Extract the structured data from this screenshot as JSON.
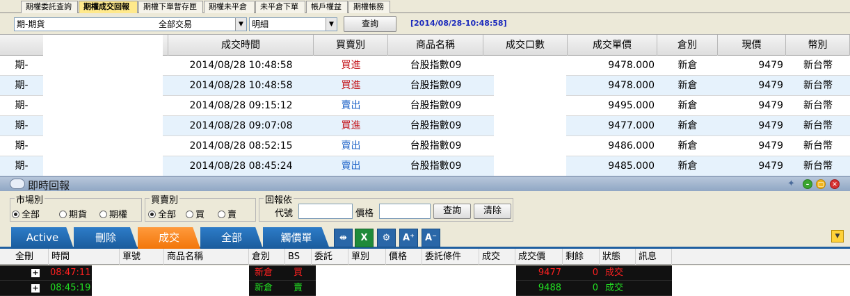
{
  "top_tabs": [
    {
      "label": "期權委託查詢"
    },
    {
      "label": "期權成交回報"
    },
    {
      "label": "期權下單暫存匣"
    },
    {
      "label": "期權未平倉"
    },
    {
      "label": "未平倉下單"
    },
    {
      "label": "帳戶權益"
    },
    {
      "label": "期權帳務"
    }
  ],
  "query": {
    "account_value": "期-期貨",
    "trade_type_value": "全部交易",
    "detail_value": "明細",
    "query_button": "查詢",
    "timestamp": "[2014/08/28-10:48:58]"
  },
  "trade_table": {
    "headers": [
      "成交時間",
      "買賣別",
      "商品名稱",
      "成交口數",
      "成交單價",
      "倉別",
      "現價",
      "幣別"
    ],
    "rows": [
      {
        "account": "期-",
        "time": "2014/08/28 10:48:58",
        "side": "買進",
        "side_type": "buy",
        "product": "台股指數09",
        "price": "9478.000",
        "position": "新倉",
        "current": "9479",
        "currency": "新台幣"
      },
      {
        "account": "期-",
        "time": "2014/08/28 10:48:58",
        "side": "買進",
        "side_type": "buy",
        "product": "台股指數09",
        "price": "9478.000",
        "position": "新倉",
        "current": "9479",
        "currency": "新台幣"
      },
      {
        "account": "期-",
        "time": "2014/08/28 09:15:12",
        "side": "賣出",
        "side_type": "sell",
        "product": "台股指數09",
        "price": "9495.000",
        "position": "新倉",
        "current": "9479",
        "currency": "新台幣"
      },
      {
        "account": "期-",
        "time": "2014/08/28 09:07:08",
        "side": "買進",
        "side_type": "buy",
        "product": "台股指數09",
        "price": "9477.000",
        "position": "新倉",
        "current": "9479",
        "currency": "新台幣"
      },
      {
        "account": "期-",
        "time": "2014/08/28 08:52:15",
        "side": "賣出",
        "side_type": "sell",
        "product": "台股指數09",
        "price": "9486.000",
        "position": "新倉",
        "current": "9479",
        "currency": "新台幣"
      },
      {
        "account": "期-",
        "time": "2014/08/28 08:45:24",
        "side": "賣出",
        "side_type": "sell",
        "product": "台股指數09",
        "price": "9485.000",
        "position": "新倉",
        "current": "9479",
        "currency": "新台幣"
      }
    ]
  },
  "realtime_panel": {
    "title": "即時回報",
    "market_group": {
      "title": "市場別",
      "options": [
        "全部",
        "期貨",
        "期權"
      ],
      "selected": 0
    },
    "side_group": {
      "title": "買賣別",
      "options": [
        "全部",
        "買",
        "賣"
      ],
      "selected": 0
    },
    "filter_group": {
      "title": "回報依",
      "code_label": "代號",
      "price_label": "價格",
      "query_button": "查詢",
      "clear_button": "清除"
    },
    "tabs": [
      "Active",
      "刪除",
      "成交",
      "全部",
      "觸價單"
    ],
    "active_tab": 2,
    "toolbar_buttons": [
      "A⁺",
      "A⁻"
    ],
    "grid_headers": [
      "全刪",
      "時間",
      "單號",
      "商品名稱",
      "倉別",
      "BS",
      "委託",
      "單別",
      "價格",
      "委託條件",
      "成交",
      "成交價",
      "剩餘",
      "狀態",
      "訊息"
    ],
    "grid_rows": [
      {
        "time": "08:47:11",
        "position": "新倉",
        "bs": "買",
        "fill_price": "9477",
        "remaining": "0",
        "status": "成交",
        "color": "#ff2020"
      },
      {
        "time": "08:45:19",
        "position": "新倉",
        "bs": "賣",
        "fill_price": "9488",
        "remaining": "0",
        "status": "成交",
        "color": "#22e022"
      }
    ]
  },
  "colors": {
    "buy": "#c4161c",
    "sell": "#1f64c8",
    "tab_blue": "#1f5fa0",
    "tab_orange": "#f2760a",
    "timestamp": "#1c2bbd"
  }
}
